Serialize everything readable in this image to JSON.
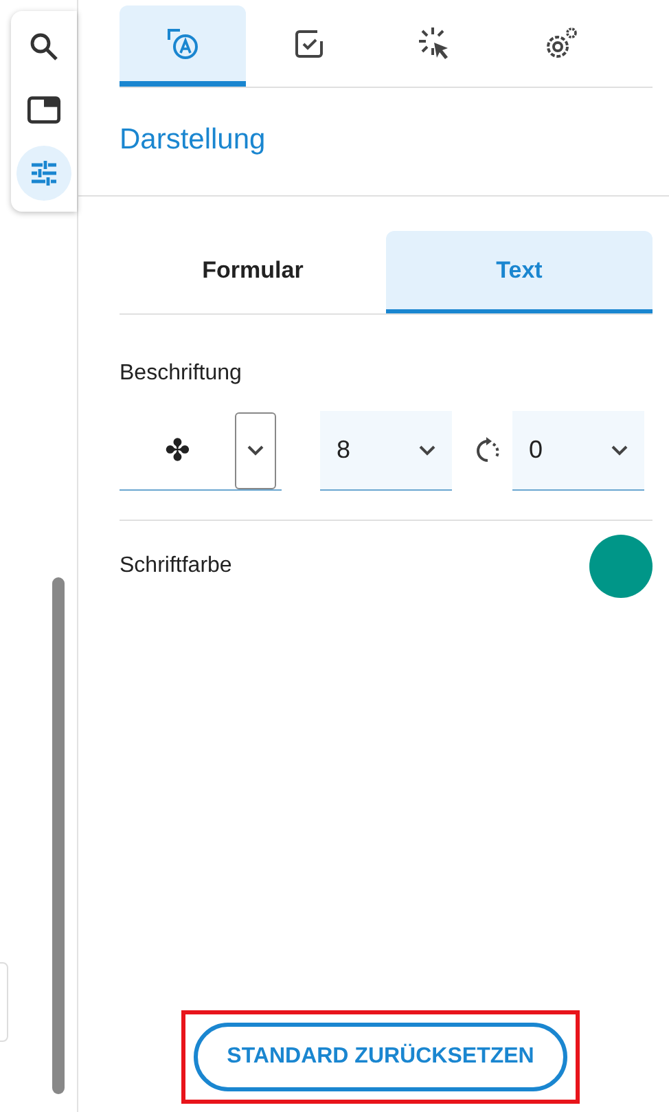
{
  "side_toolbar": {
    "items": [
      {
        "kind": "search",
        "selected": false
      },
      {
        "kind": "window",
        "selected": false
      },
      {
        "kind": "sliders",
        "selected": true
      }
    ]
  },
  "icon_tabs": [
    {
      "kind": "appearance",
      "selected": true
    },
    {
      "kind": "checkbox",
      "selected": false
    },
    {
      "kind": "click",
      "selected": false
    },
    {
      "kind": "settings",
      "selected": false
    }
  ],
  "section_title": "Darstellung",
  "segments": [
    {
      "label": "Formular",
      "selected": false
    },
    {
      "label": "Text",
      "selected": true
    }
  ],
  "label_settings": {
    "title": "Beschriftung",
    "selects": [
      {
        "kind": "symbol",
        "value": "✤"
      },
      {
        "kind": "number",
        "value": "8"
      },
      {
        "kind": "rotation",
        "value": "0"
      }
    ]
  },
  "font_color": {
    "label": "Schriftfarbe",
    "color": "#009688"
  },
  "reset_button": {
    "label": "STANDARD ZURÜCKSETZEN",
    "highlighted": true
  }
}
